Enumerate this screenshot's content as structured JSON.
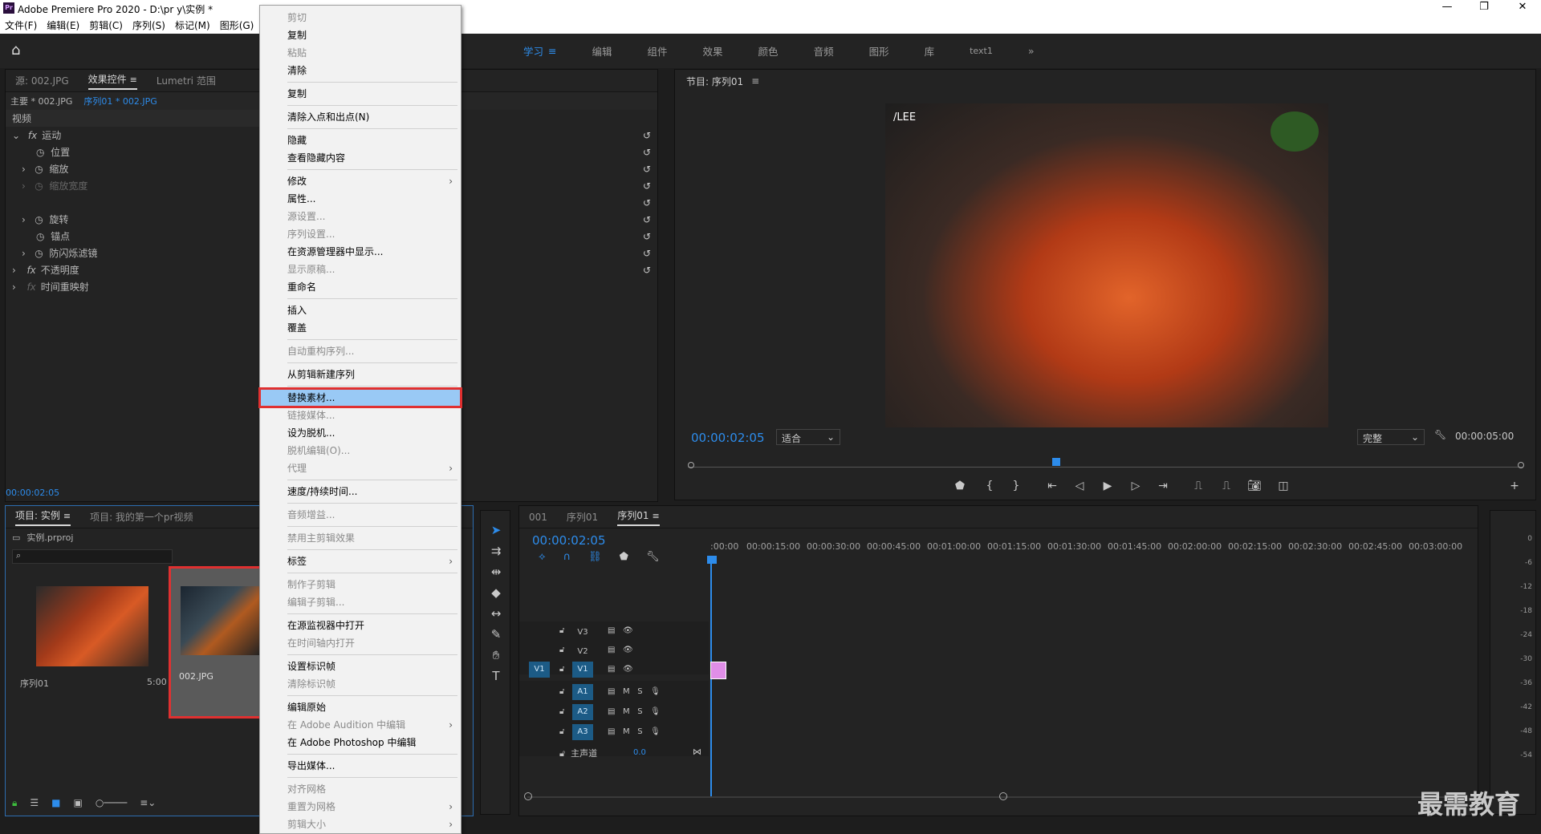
{
  "window": {
    "title": "Adobe Premiere Pro 2020 - D:\\pr y\\实例 *",
    "app_badge": "Pr"
  },
  "menu": [
    "文件(F)",
    "编辑(E)",
    "剪辑(C)",
    "序列(S)",
    "标记(M)",
    "图形(G)"
  ],
  "workspaces": [
    "学习",
    "编辑",
    "组件",
    "效果",
    "颜色",
    "音频",
    "图形",
    "库",
    "text1"
  ],
  "source_panel": {
    "tabs": [
      "源: 002.JPG",
      "效果控件",
      "Lumetri 范围"
    ],
    "clip_master": "主要 * 002.JPG",
    "clip_seq": "序列01 * 002.JPG",
    "section": "视频",
    "rows": [
      "运动",
      "位置",
      "缩放",
      "缩放宽度",
      "旋转",
      "锚点",
      "防闪烁滤镜",
      "不透明度",
      "时间重映射"
    ],
    "timecode": "00:00:02:05"
  },
  "project": {
    "tabs": [
      "项目: 实例",
      "项目: 我的第一个pr视频"
    ],
    "file": "实例.prproj",
    "items": [
      {
        "name": "序列01",
        "duration": "5:00"
      },
      {
        "name": "002.JPG"
      }
    ]
  },
  "context_menu": {
    "groups": [
      [
        {
          "label": "剪切",
          "disabled": true
        },
        {
          "label": "复制"
        },
        {
          "label": "粘贴",
          "disabled": true
        },
        {
          "label": "清除"
        }
      ],
      [
        {
          "label": "复制"
        }
      ],
      [
        {
          "label": "清除入点和出点(N)"
        }
      ],
      [
        {
          "label": "隐藏"
        },
        {
          "label": "查看隐藏内容"
        }
      ],
      [
        {
          "label": "修改",
          "sub": true
        },
        {
          "label": "属性..."
        },
        {
          "label": "源设置...",
          "disabled": true
        },
        {
          "label": "序列设置...",
          "disabled": true
        },
        {
          "label": "在资源管理器中显示..."
        },
        {
          "label": "显示原稿...",
          "disabled": true
        },
        {
          "label": "重命名"
        }
      ],
      [
        {
          "label": "插入"
        },
        {
          "label": "覆盖"
        }
      ],
      [
        {
          "label": "自动重构序列...",
          "disabled": true
        }
      ],
      [
        {
          "label": "从剪辑新建序列"
        }
      ],
      [
        {
          "label": "替换素材...",
          "highlight": true
        },
        {
          "label": "链接媒体...",
          "disabled": true
        },
        {
          "label": "设为脱机..."
        },
        {
          "label": "脱机编辑(O)...",
          "disabled": true
        },
        {
          "label": "代理",
          "disabled": true,
          "sub": true
        }
      ],
      [
        {
          "label": "速度/持续时间..."
        }
      ],
      [
        {
          "label": "音频增益...",
          "disabled": true
        }
      ],
      [
        {
          "label": "禁用主剪辑效果",
          "disabled": true
        }
      ],
      [
        {
          "label": "标签",
          "sub": true
        }
      ],
      [
        {
          "label": "制作子剪辑",
          "disabled": true
        },
        {
          "label": "编辑子剪辑...",
          "disabled": true
        }
      ],
      [
        {
          "label": "在源监视器中打开"
        },
        {
          "label": "在时间轴内打开",
          "disabled": true
        }
      ],
      [
        {
          "label": "设置标识帧"
        },
        {
          "label": "清除标识帧",
          "disabled": true
        }
      ],
      [
        {
          "label": "编辑原始"
        },
        {
          "label": "在 Adobe Audition 中编辑",
          "disabled": true,
          "sub": true
        },
        {
          "label": "在 Adobe Photoshop 中编辑"
        }
      ],
      [
        {
          "label": "导出媒体..."
        }
      ],
      [
        {
          "label": "对齐网格",
          "disabled": true
        },
        {
          "label": "重置为网格",
          "disabled": true,
          "sub": true
        },
        {
          "label": "剪辑大小",
          "disabled": true,
          "sub": true
        }
      ]
    ]
  },
  "program": {
    "title": "节目: 序列01",
    "timecode": "00:00:02:05",
    "fit": "适合",
    "quality": "完整",
    "duration": "00:00:05:00",
    "watermark": "/LEE"
  },
  "timeline": {
    "tabs": [
      "001",
      "序列01",
      "序列01"
    ],
    "timecode": "00:00:02:05",
    "ruler": [
      ":00:00",
      "00:00:15:00",
      "00:00:30:00",
      "00:00:45:00",
      "00:01:00:00",
      "00:01:15:00",
      "00:01:30:00",
      "00:01:45:00",
      "00:02:00:00",
      "00:02:15:00",
      "00:02:30:00",
      "00:02:45:00",
      "00:03:00:00"
    ],
    "video_tracks": [
      "V3",
      "V2",
      "V1"
    ],
    "audio_tracks": [
      "A1",
      "A2",
      "A3"
    ],
    "master": "主声道",
    "master_val": "0.0",
    "src_patch": "V1"
  },
  "meter": [
    "0",
    "-6",
    "-12",
    "-18",
    "-24",
    "-30",
    "-36",
    "-42",
    "-48",
    "-54"
  ],
  "brand": "最需教育"
}
